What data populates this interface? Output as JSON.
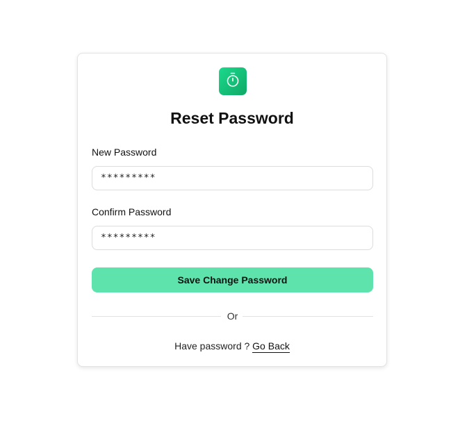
{
  "logo": {
    "icon": "stopwatch-icon",
    "gradient": [
      "#1bd98c",
      "#0fa966"
    ]
  },
  "title": "Reset Password",
  "form": {
    "new_password": {
      "label": "New Password",
      "value": "*********"
    },
    "confirm_password": {
      "label": "Confirm Password",
      "value": "*********"
    },
    "submit_label": "Save Change Password"
  },
  "divider_text": "Or",
  "footer": {
    "prompt": "Have password ?",
    "link_label": "Go Back"
  },
  "colors": {
    "accent": "#5fe3ad",
    "border": "#dcdcdc"
  }
}
